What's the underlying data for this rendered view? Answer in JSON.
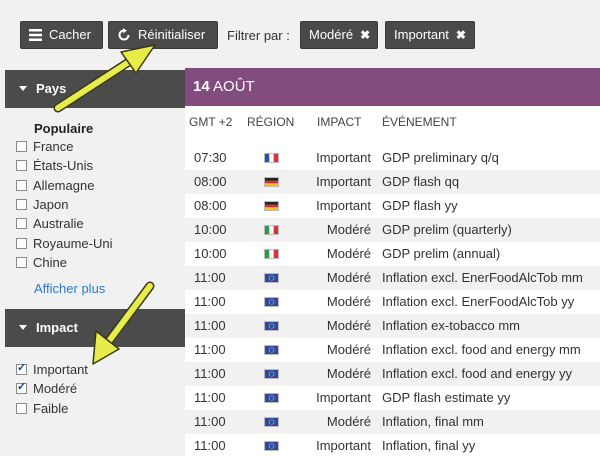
{
  "toolbar": {
    "hide_label": "Cacher",
    "reset_label": "Réinitialiser",
    "filter_label": "Filtrer par :",
    "chips": [
      {
        "label": "Modéré"
      },
      {
        "label": "Important"
      }
    ]
  },
  "sidebar": {
    "country_heading": "Pays",
    "popular_label": "Populaire",
    "countries": [
      {
        "label": "France",
        "checked": false
      },
      {
        "label": "États-Unis",
        "checked": false
      },
      {
        "label": "Allemagne",
        "checked": false
      },
      {
        "label": "Japon",
        "checked": false
      },
      {
        "label": "Australie",
        "checked": false
      },
      {
        "label": "Royaume-Uni",
        "checked": false
      },
      {
        "label": "Chine",
        "checked": false
      }
    ],
    "show_more": "Afficher plus",
    "impact_heading": "Impact",
    "impacts": [
      {
        "label": "Important",
        "checked": true
      },
      {
        "label": "Modéré",
        "checked": true
      },
      {
        "label": "Faible",
        "checked": false
      }
    ]
  },
  "main": {
    "date_day": "14",
    "date_month": "AOÛT",
    "columns": {
      "time": "GMT +2",
      "region": "RÉGION",
      "impact": "IMPACT",
      "event": "ÉVÉNEMENT"
    },
    "events": [
      {
        "time": "07:30",
        "flag": "flag-france",
        "impact": "Important",
        "event": "GDP preliminary q/q"
      },
      {
        "time": "08:00",
        "flag": "flag-germany",
        "impact": "Important",
        "event": "GDP flash qq"
      },
      {
        "time": "08:00",
        "flag": "flag-germany",
        "impact": "Important",
        "event": "GDP flash yy"
      },
      {
        "time": "10:00",
        "flag": "flag-italy",
        "impact": "Modéré",
        "event": "GDP prelim (quarterly)"
      },
      {
        "time": "10:00",
        "flag": "flag-italy",
        "impact": "Modéré",
        "event": "GDP prelim (annual)"
      },
      {
        "time": "11:00",
        "flag": "flag-eu",
        "impact": "Modéré",
        "event": "Inflation excl. EnerFoodAlcTob mm"
      },
      {
        "time": "11:00",
        "flag": "flag-eu",
        "impact": "Modéré",
        "event": "Inflation excl. EnerFoodAlcTob yy"
      },
      {
        "time": "11:00",
        "flag": "flag-eu",
        "impact": "Modéré",
        "event": "Inflation ex-tobacco mm"
      },
      {
        "time": "11:00",
        "flag": "flag-eu",
        "impact": "Modéré",
        "event": "Inflation excl. food and energy mm"
      },
      {
        "time": "11:00",
        "flag": "flag-eu",
        "impact": "Modéré",
        "event": "Inflation excl. food and energy yy"
      },
      {
        "time": "11:00",
        "flag": "flag-eu",
        "impact": "Important",
        "event": "GDP flash estimate yy"
      },
      {
        "time": "11:00",
        "flag": "flag-eu",
        "impact": "Modéré",
        "event": "Inflation, final mm"
      },
      {
        "time": "11:00",
        "flag": "flag-eu",
        "impact": "Important",
        "event": "Inflation, final yy"
      }
    ]
  },
  "colors": {
    "date_bar": "#824d7e",
    "button_dark": "#4a4a4a",
    "link": "#2f78c4",
    "arrow": "#e8ec4a"
  }
}
